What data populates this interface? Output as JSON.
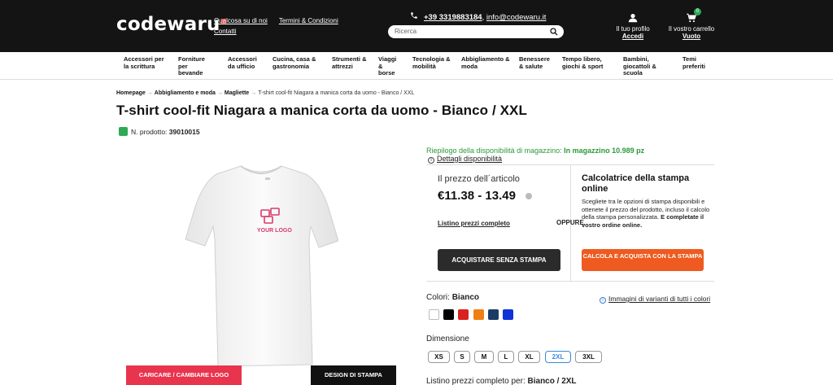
{
  "header": {
    "logo": "codewaru",
    "links": [
      "Qualcosa su di noi",
      "Termini & Condizioni",
      "Contatti"
    ],
    "phone": "+39 3319883184",
    "email": "info@codewaru.it",
    "search_placeholder": "Ricerca",
    "profile_line1": "Il tuo profilo",
    "profile_line2": "Accedi",
    "cart_line1": "Il vostro carrello",
    "cart_line2": "Vuoto",
    "cart_count": "0"
  },
  "categories": [
    "Accessori per la scrittura",
    "Forniture per bevande",
    "Accessori da ufficio",
    "Cucina, casa & gastronomia",
    "Strumenti & attrezzi",
    "Viaggi & borse",
    "Tecnologia & mobilità",
    "Abbigliamento & moda",
    "Benessere & salute",
    "Tempo libero, giochi & sport",
    "Bambini, giocattoli & scuola",
    "Temi preferiti"
  ],
  "breadcrumb": {
    "items": [
      "Homepage",
      "Abbigliamento e moda",
      "Magliette"
    ],
    "current": "T-shirt cool-fit Niagara a manica corta da uomo - Bianco / XXL"
  },
  "product": {
    "title": "T-shirt cool-fit Niagara a manica corta da uomo - Bianco / XXL",
    "number_label": "N. prodotto:",
    "number": "39010015",
    "logo_text": "YOUR LOGO"
  },
  "image_buttons": {
    "upload": "CARICARE / CAMBIARE LOGO",
    "design": "DESIGN DI STAMPA"
  },
  "availability": {
    "label": "Riepilogo della disponibilità di magazzino:",
    "value": "In magazzino 10.989 pz",
    "details": "Dettagli disponibilità"
  },
  "pricing": {
    "label": "Il prezzo dell´articolo",
    "price": "€11.38 - 13.49",
    "listino": "Listino prezzi completo",
    "oppure": "OPPURE",
    "buy_button": "ACQUISTARE SENZA STAMPA"
  },
  "calculator": {
    "title": "Calcolatrice della stampa online",
    "desc_plain": "Scegliete tra le opzioni di stampa disponibili e ottenete il prezzo del prodotto, incluso il calcolo della stampa personalizzata.",
    "desc_bold": "E completate il vostro ordine online.",
    "button": "CALCOLA E ACQUISTA CON LA STAMPA"
  },
  "colors": {
    "label": "Colori:",
    "selected": "Bianco",
    "variants_link": "Immagini di varianti di tutti i colori",
    "swatches": [
      "#ffffff",
      "#000000",
      "#d9221f",
      "#f07f13",
      "#1c3c66",
      "#1032d8"
    ]
  },
  "dimension": {
    "label": "Dimensione",
    "sizes": [
      "XS",
      "S",
      "M",
      "L",
      "XL",
      "2XL",
      "3XL"
    ],
    "selected": "2XL"
  },
  "listino_bottom": {
    "label": "Listino prezzi completo per:",
    "value": "Bianco / 2XL"
  }
}
